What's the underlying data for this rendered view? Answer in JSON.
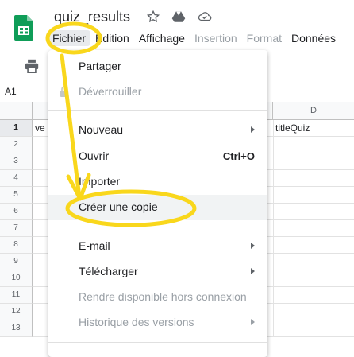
{
  "app": {
    "doc_title": "quiz_results",
    "icons": [
      "star-icon",
      "drive-move-icon",
      "cloud-saved-icon"
    ]
  },
  "menubar": {
    "items": [
      {
        "label": "Fichier",
        "state": "active"
      },
      {
        "label": "Édition",
        "state": "normal"
      },
      {
        "label": "Affichage",
        "state": "normal"
      },
      {
        "label": "Insertion",
        "state": "disabled"
      },
      {
        "label": "Format",
        "state": "disabled"
      },
      {
        "label": "Données",
        "state": "normal"
      }
    ]
  },
  "toolbar": {
    "print_icon": "print-icon"
  },
  "formula_bar": {
    "cell_ref": "A1"
  },
  "grid": {
    "columns": [
      {
        "label": ""
      },
      {
        "label": ""
      },
      {
        "label": ""
      },
      {
        "label": "D"
      }
    ],
    "rows": [
      "1",
      "2",
      "3",
      "4",
      "5",
      "6",
      "7",
      "8",
      "9",
      "10",
      "11",
      "12",
      "13"
    ],
    "cells": {
      "A1": "ve",
      "D1": "titleQuiz"
    }
  },
  "file_menu": {
    "sections": [
      [
        {
          "label": "Partager",
          "disabled": false
        },
        {
          "label": "Déverrouiller",
          "disabled": true,
          "icon": "lock-icon"
        }
      ],
      [
        {
          "label": "Nouveau",
          "disabled": false,
          "submenu": true
        },
        {
          "label": "Ouvrir",
          "disabled": false,
          "shortcut": "Ctrl+O"
        },
        {
          "label": "Importer",
          "disabled": false
        },
        {
          "label": "Créer une copie",
          "disabled": false,
          "highlighted": true
        }
      ],
      [
        {
          "label": "E-mail",
          "disabled": false,
          "submenu": true
        },
        {
          "label": "Télécharger",
          "disabled": false,
          "submenu": true
        },
        {
          "label": "Rendre disponible hors connexion",
          "disabled": true
        },
        {
          "label": "Historique des versions",
          "disabled": true,
          "submenu": true
        }
      ]
    ]
  },
  "annotation": {
    "color": "#f9d71c"
  }
}
